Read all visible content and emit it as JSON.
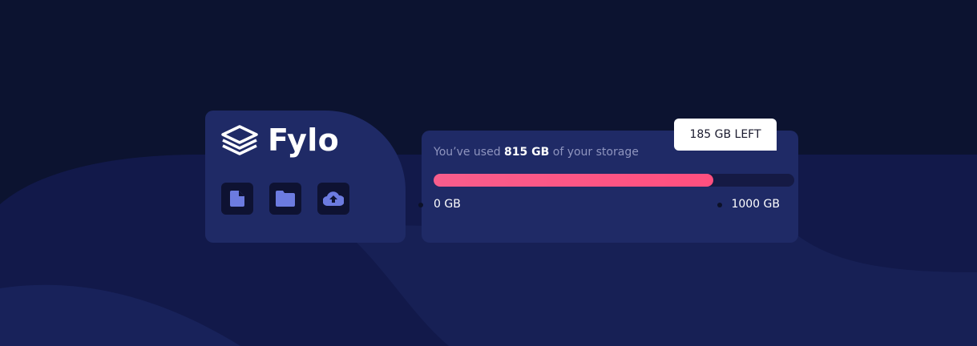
{
  "brand": {
    "name": "Fylo",
    "logo_icon": "layers-icon"
  },
  "actions": [
    {
      "icon": "document-icon"
    },
    {
      "icon": "folder-icon"
    },
    {
      "icon": "cloud-upload-icon"
    }
  ],
  "storage": {
    "prefix": "You’ve used ",
    "used": "815 GB",
    "suffix": " of your storage",
    "min_label": "0 GB",
    "max_label": "1000 GB",
    "remaining_label": "185 GB LEFT",
    "used_fraction": 0.815
  },
  "colors": {
    "background": "#0c1330",
    "card": "#1f2a66",
    "accent": "#f75d8c",
    "icon_tint": "#6c7be0"
  }
}
